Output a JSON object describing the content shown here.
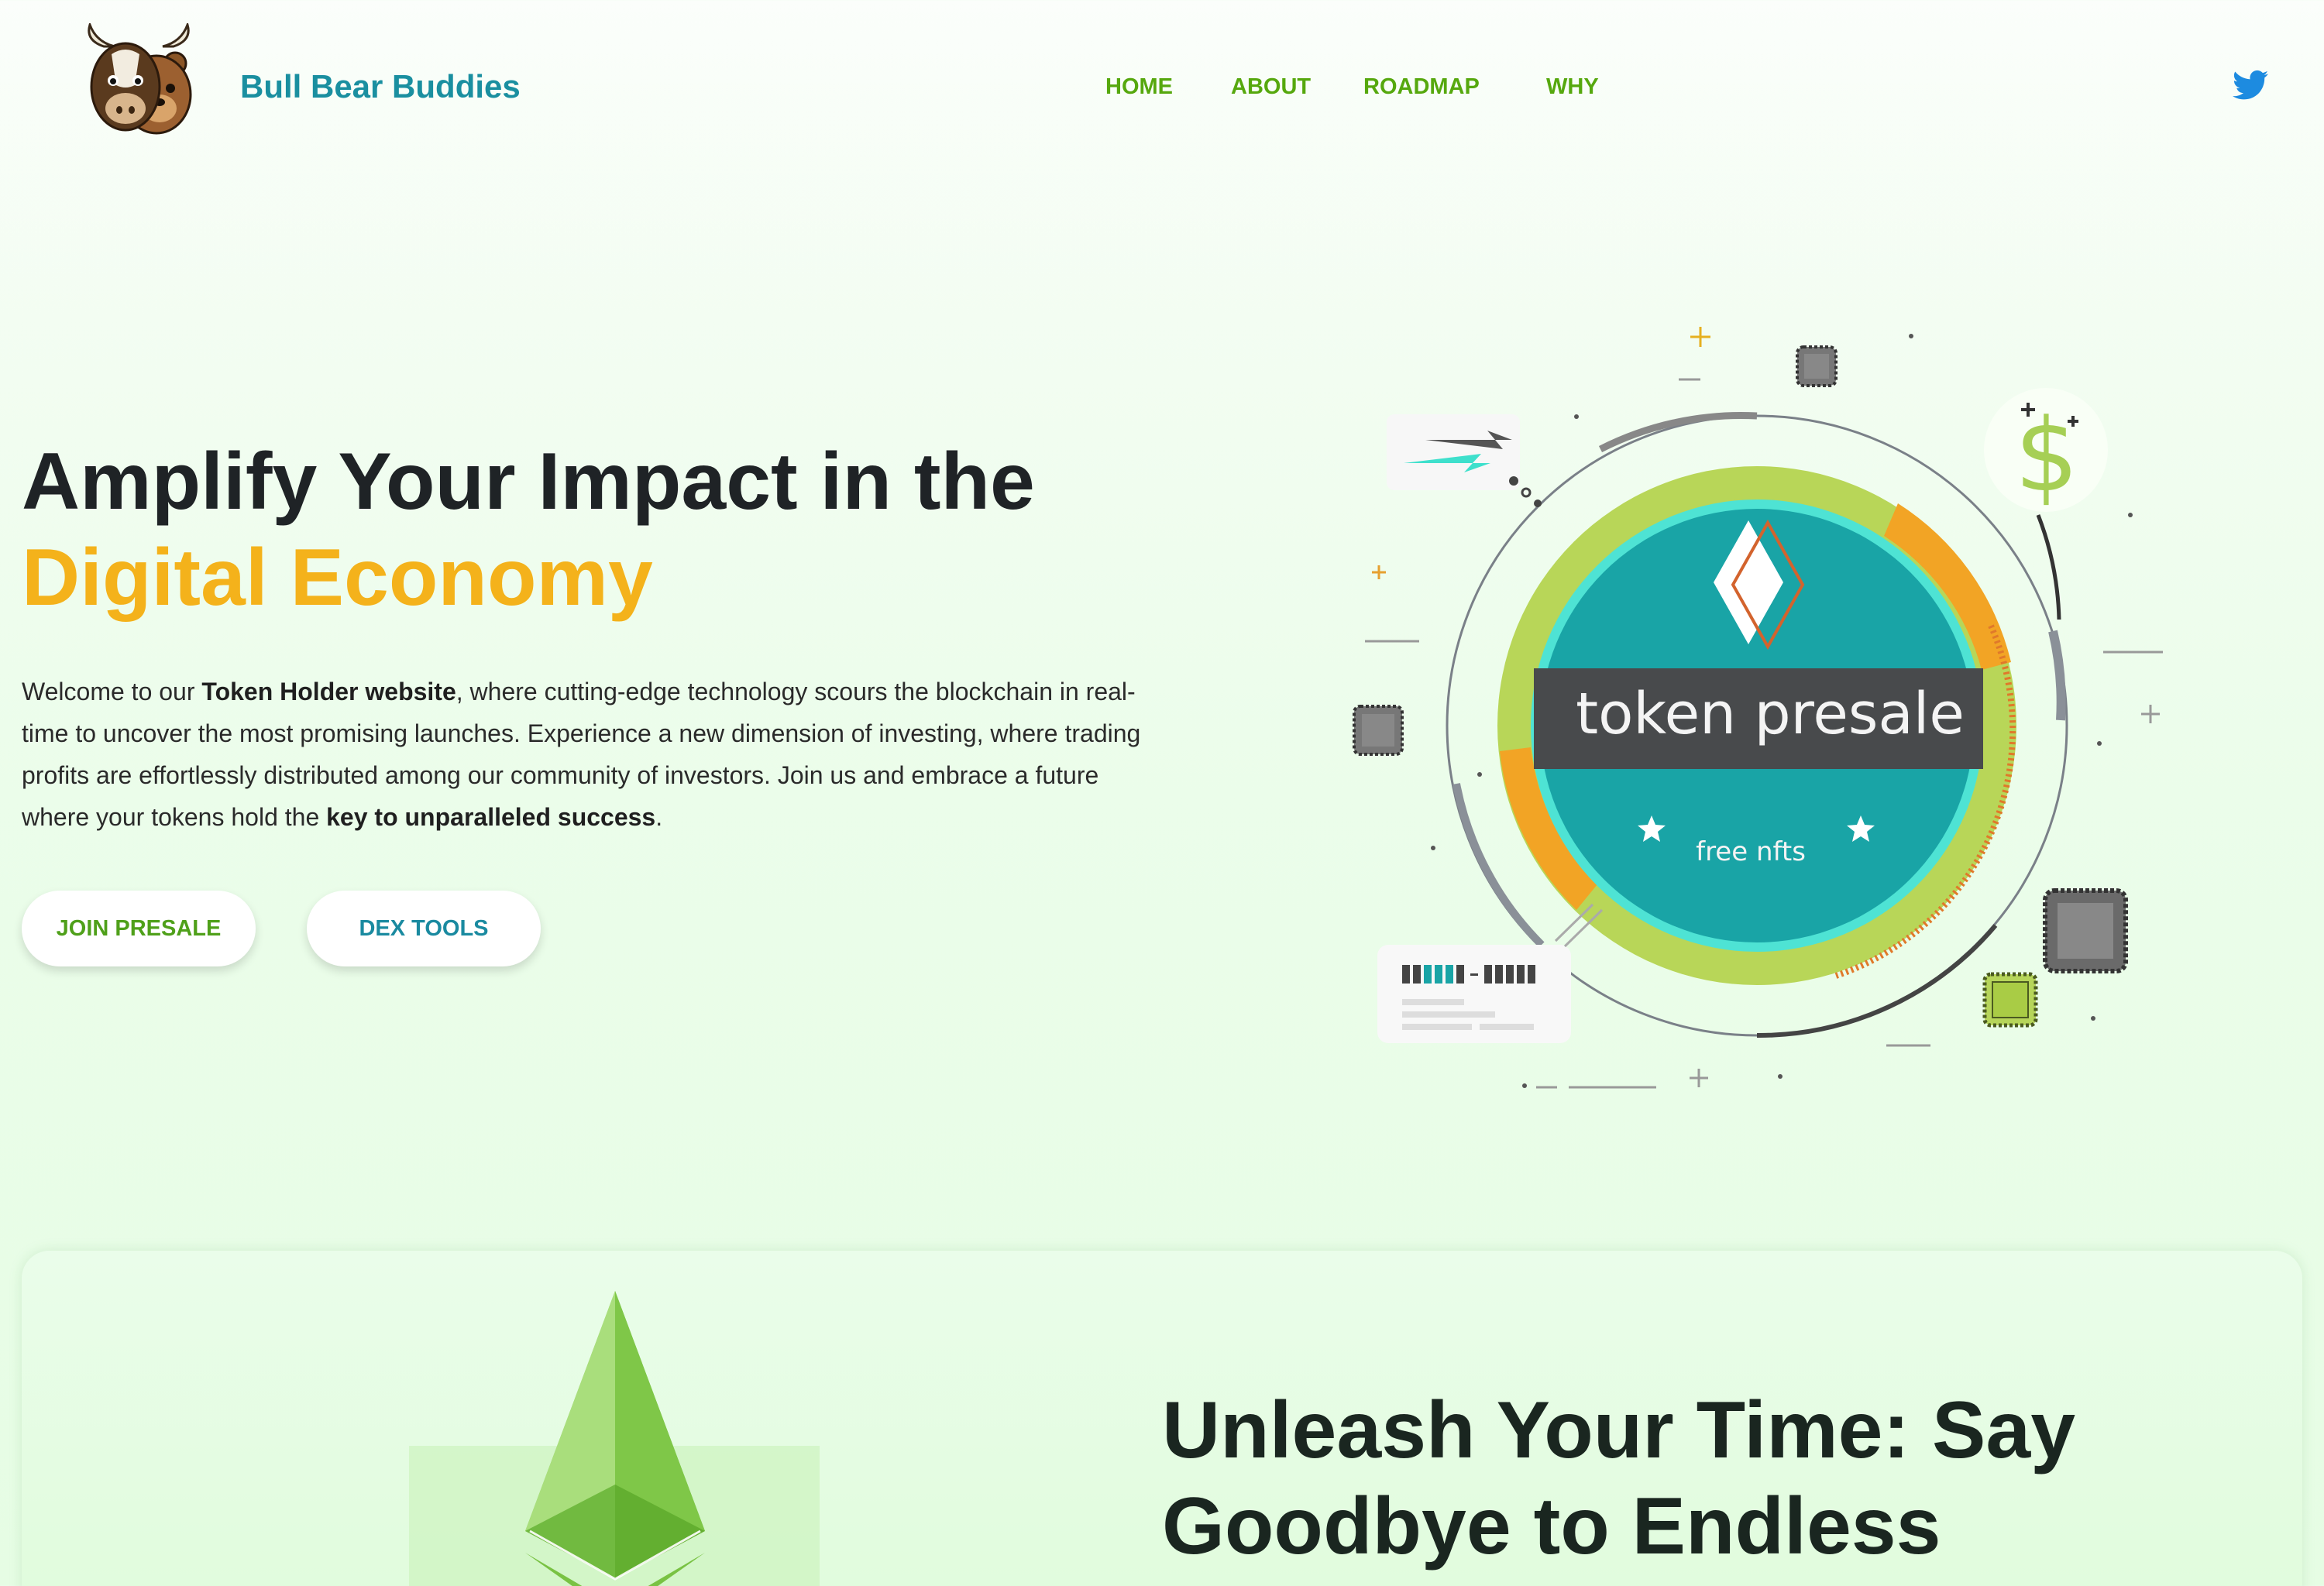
{
  "header": {
    "brand": "Bull Bear Buddies",
    "logo_icon": "bull-bear-mascot-logo",
    "nav": [
      {
        "label": "HOME"
      },
      {
        "label": "ABOUT"
      },
      {
        "label": "ROADMAP"
      },
      {
        "label": "WHY"
      }
    ],
    "social_icon": "twitter-icon"
  },
  "hero": {
    "title_line1": "Amplify Your Impact in the",
    "title_line2": "Digital Economy",
    "description": {
      "p1": "Welcome to our ",
      "b1": "Token Holder website",
      "p2": ", where cutting-edge technology scours the blockchain in real-time to uncover the most promising launches. Experience a new dimension of investing, where trading profits are effortlessly distributed among our community of investors. Join us and embrace a future where your tokens hold the ",
      "b2": "key to unparalleled success",
      "p3": "."
    },
    "buttons": {
      "presale": "JOIN PRESALE",
      "dex": "DEX TOOLS"
    },
    "illustration": {
      "banner_text": "token presale",
      "sub_text": "free nfts",
      "currency_symbol": "$"
    }
  },
  "section2": {
    "title": "Unleash Your Time: Say Goodbye to Endless",
    "image_icon": "ethereum-icon"
  },
  "colors": {
    "brand": "#1a8fa0",
    "nav": "#56a80e",
    "accent": "#f4b21b",
    "teal": "#1aa7a8",
    "lime": "#b5d55a"
  }
}
